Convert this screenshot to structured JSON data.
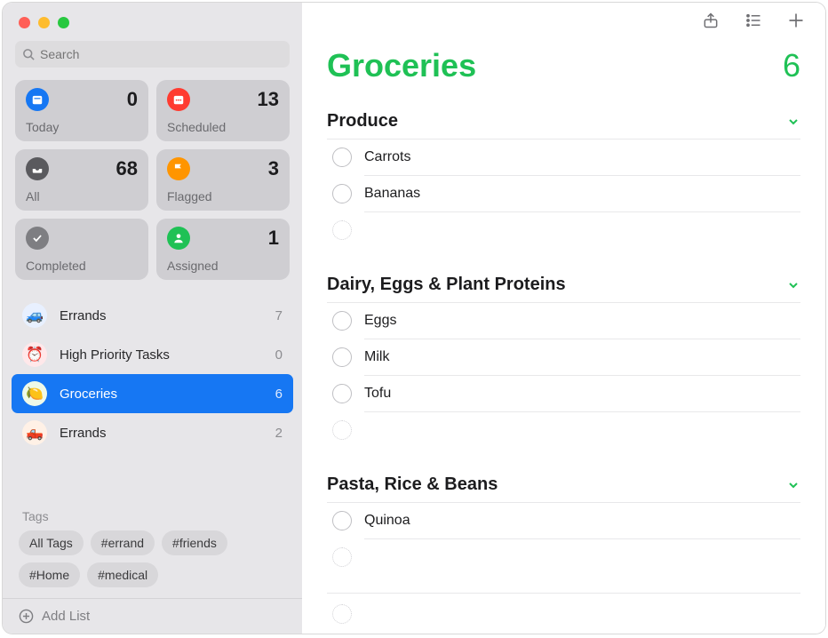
{
  "search": {
    "placeholder": "Search"
  },
  "smart": {
    "today": {
      "label": "Today",
      "count": 0,
      "color": "#1677f3"
    },
    "scheduled": {
      "label": "Scheduled",
      "count": 13,
      "color": "#ff3b30"
    },
    "all": {
      "label": "All",
      "count": 68,
      "color": "#5a5a5e"
    },
    "flagged": {
      "label": "Flagged",
      "count": 3,
      "color": "#ff9500"
    },
    "completed": {
      "label": "Completed",
      "count": "",
      "color": "#7e7e82"
    },
    "assigned": {
      "label": "Assigned",
      "count": 1,
      "color": "#1fc155"
    }
  },
  "lists": [
    {
      "name": "Errands",
      "count": 7,
      "emoji": "🚙",
      "iconbg": "#e8f0ff",
      "selected": false
    },
    {
      "name": "High Priority Tasks",
      "count": 0,
      "emoji": "⏰",
      "iconbg": "#ffe8ea",
      "selected": false
    },
    {
      "name": "Groceries",
      "count": 6,
      "emoji": "🍋",
      "iconbg": "#eef9e8",
      "selected": true
    },
    {
      "name": "Errands",
      "count": 2,
      "emoji": "🛻",
      "iconbg": "#fff1e6",
      "selected": false
    }
  ],
  "tagsHeader": "Tags",
  "tags": [
    "All Tags",
    "#errand",
    "#friends",
    "#Home",
    "#medical"
  ],
  "addList": "Add List",
  "main": {
    "title": "Groceries",
    "count": 6,
    "sections": [
      {
        "title": "Produce",
        "items": [
          "Carrots",
          "Bananas"
        ]
      },
      {
        "title": "Dairy, Eggs & Plant Proteins",
        "items": [
          "Eggs",
          "Milk",
          "Tofu"
        ]
      },
      {
        "title": "Pasta, Rice & Beans",
        "items": [
          "Quinoa"
        ]
      }
    ]
  }
}
